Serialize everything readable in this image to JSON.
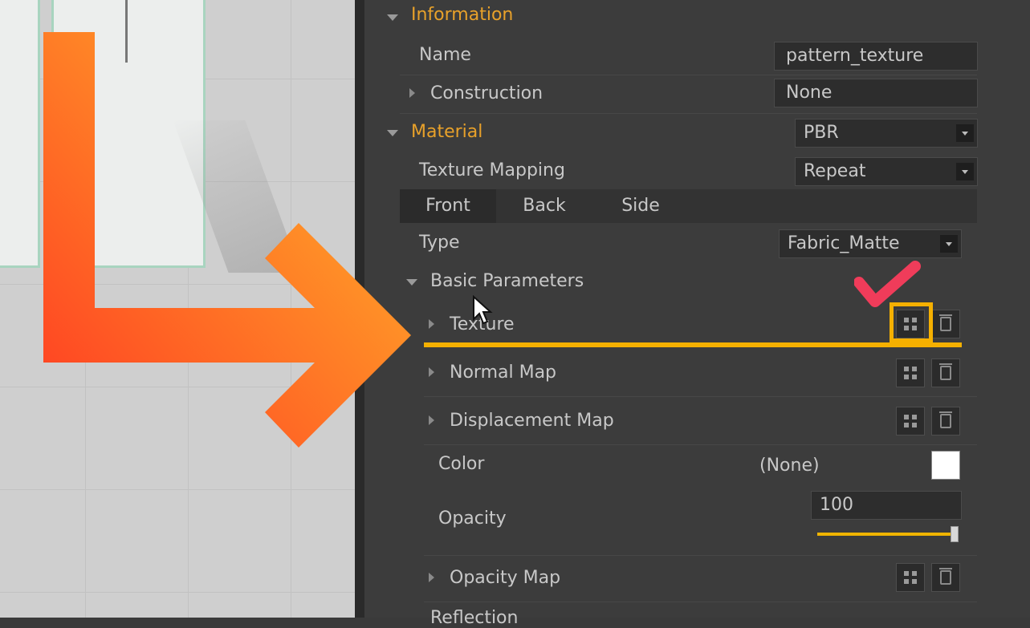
{
  "panel": {
    "information": {
      "title": "Information"
    },
    "name": {
      "label": "Name",
      "value": "pattern_texture"
    },
    "construction": {
      "label": "Construction",
      "value": "None"
    },
    "material": {
      "title": "Material",
      "value": "PBR"
    },
    "texture_mapping": {
      "label": "Texture Mapping",
      "value": "Repeat"
    },
    "tabs": [
      "Front",
      "Back",
      "Side"
    ],
    "type": {
      "label": "Type",
      "value": "Fabric_Matte"
    },
    "basic_parameters": {
      "title": "Basic Parameters"
    },
    "texture": {
      "label": "Texture"
    },
    "normal_map": {
      "label": "Normal Map"
    },
    "displacement_map": {
      "label": "Displacement Map"
    },
    "color": {
      "label": "Color",
      "value": "(None)",
      "swatch": "#ffffff"
    },
    "opacity": {
      "label": "Opacity",
      "value": "100",
      "level": 1.0
    },
    "opacity_map": {
      "label": "Opacity Map"
    },
    "reflection": {
      "label": "Reflection"
    }
  },
  "colors": {
    "accent": "#e8a12a",
    "highlight": "#f5b000",
    "check": "#f03c5a"
  },
  "icons": [
    "grid-icon",
    "trash-icon",
    "caret-down-icon",
    "caret-right-icon",
    "cursor-icon",
    "check-mark-icon",
    "arrow-icon"
  ]
}
